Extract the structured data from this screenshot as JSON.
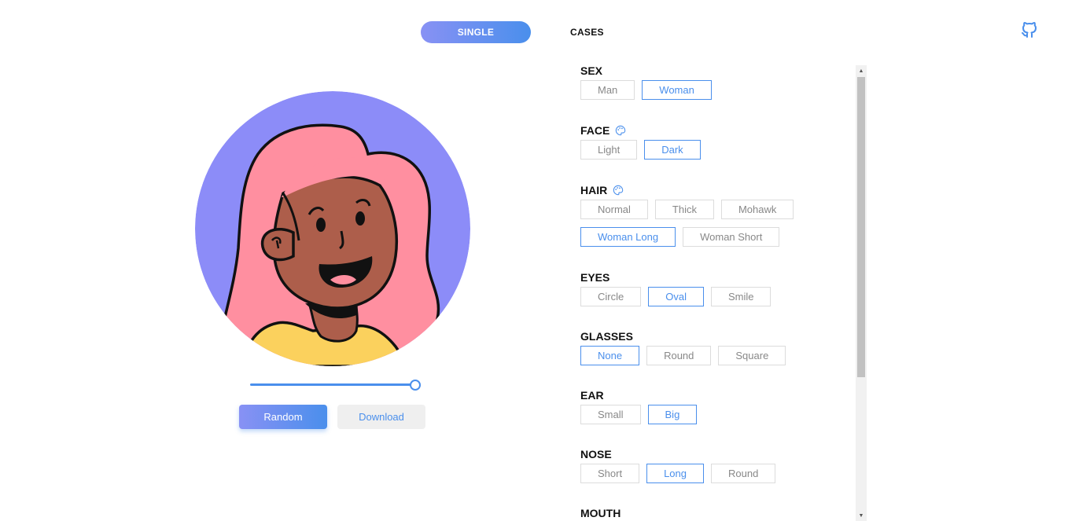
{
  "nav": {
    "tabs": [
      {
        "label": "SINGLE",
        "active": true
      },
      {
        "label": "CASES",
        "active": false
      }
    ],
    "github_icon": "github-icon"
  },
  "preview": {
    "colors": {
      "background": "#8c8cf8",
      "hair": "#ff8fa0",
      "skin": "#ad5e4b",
      "shirt": "#fbd15d",
      "accent": "#4a8fec"
    },
    "size_slider_value": 1.0
  },
  "actions": {
    "random_label": "Random",
    "download_label": "Download"
  },
  "options": [
    {
      "title": "SEX",
      "palette": false,
      "items": [
        {
          "label": "Man",
          "active": false
        },
        {
          "label": "Woman",
          "active": true
        }
      ]
    },
    {
      "title": "FACE",
      "palette": true,
      "items": [
        {
          "label": "Light",
          "active": false
        },
        {
          "label": "Dark",
          "active": true
        }
      ]
    },
    {
      "title": "HAIR",
      "palette": true,
      "items": [
        {
          "label": "Normal",
          "active": false
        },
        {
          "label": "Thick",
          "active": false
        },
        {
          "label": "Mohawk",
          "active": false
        },
        {
          "label": "Woman Long",
          "active": true
        },
        {
          "label": "Woman Short",
          "active": false
        }
      ]
    },
    {
      "title": "EYES",
      "palette": false,
      "items": [
        {
          "label": "Circle",
          "active": false
        },
        {
          "label": "Oval",
          "active": true
        },
        {
          "label": "Smile",
          "active": false
        }
      ]
    },
    {
      "title": "GLASSES",
      "palette": false,
      "items": [
        {
          "label": "None",
          "active": true
        },
        {
          "label": "Round",
          "active": false
        },
        {
          "label": "Square",
          "active": false
        }
      ]
    },
    {
      "title": "EAR",
      "palette": false,
      "items": [
        {
          "label": "Small",
          "active": false
        },
        {
          "label": "Big",
          "active": true
        }
      ]
    },
    {
      "title": "NOSE",
      "palette": false,
      "items": [
        {
          "label": "Short",
          "active": false
        },
        {
          "label": "Long",
          "active": true
        },
        {
          "label": "Round",
          "active": false
        }
      ]
    },
    {
      "title": "MOUTH",
      "palette": false,
      "items": []
    }
  ]
}
